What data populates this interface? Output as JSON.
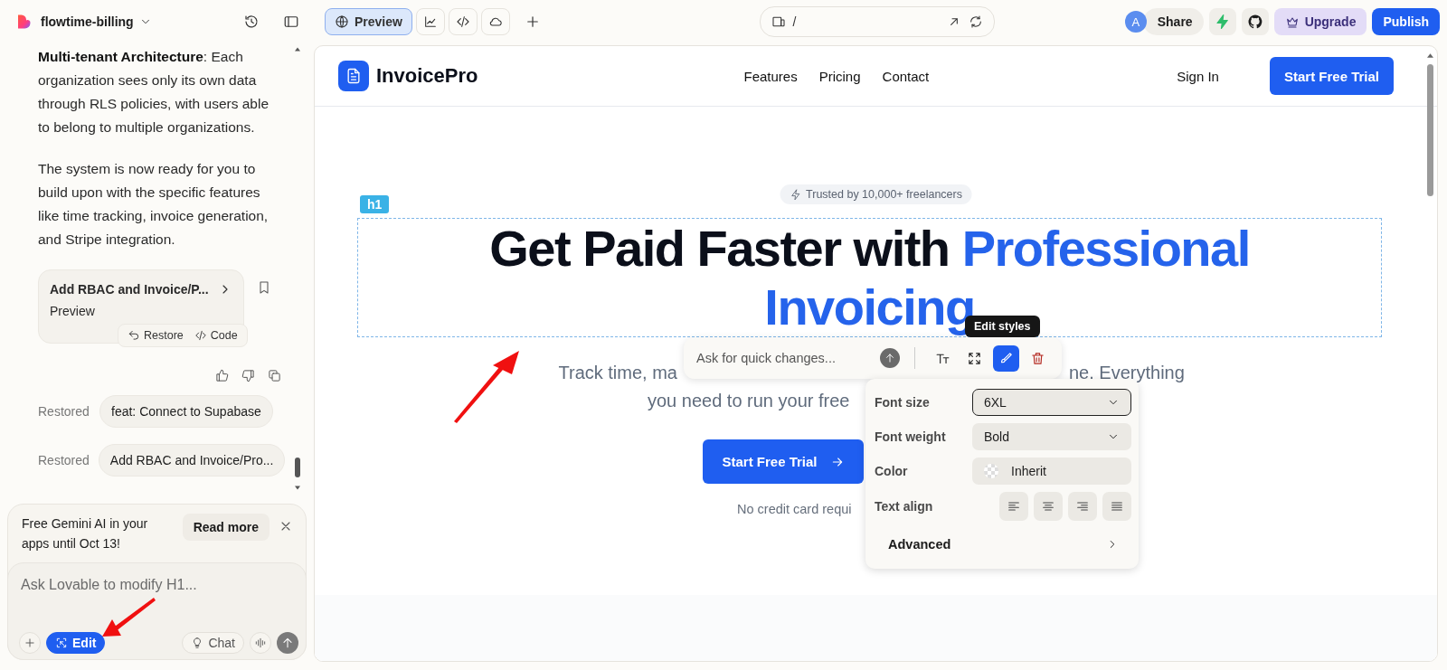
{
  "project": {
    "name": "flowtime-billing"
  },
  "view_tabs": [
    {
      "kind": "preview",
      "label": "Preview",
      "selected": true
    },
    {
      "kind": "chart",
      "selected": false
    },
    {
      "kind": "code",
      "selected": false
    },
    {
      "kind": "cloud",
      "selected": false
    }
  ],
  "address_bar": {
    "path": "/"
  },
  "header_actions": {
    "avatar": "A",
    "share": "Share",
    "upgrade": "Upgrade",
    "publish": "Publish"
  },
  "chat": {
    "paragraphs": [
      "**Multi-tenant Architecture**: Each organization sees only its own data through RLS policies, with users able to belong to multiple organizations.",
      "The system is now ready for you to build upon with the specific features like time tracking, invoice generation, and Stripe integration."
    ],
    "version_card": {
      "title": "Add RBAC and Invoice/P...",
      "subtitle": "Preview",
      "actions": [
        {
          "kind": "restore",
          "label": "Restore"
        },
        {
          "kind": "code",
          "label": "Code"
        }
      ]
    },
    "history": [
      {
        "label": "Restored",
        "commit": "feat: Connect to Supabase"
      },
      {
        "label": "Restored",
        "commit": "Add RBAC and Invoice/Pro..."
      }
    ]
  },
  "promo": {
    "text": "Free Gemini AI in your apps until Oct 13!",
    "button": "Read more"
  },
  "composer": {
    "placeholder": "Ask Lovable to modify H1...",
    "modes": [
      {
        "kind": "edit",
        "label": "Edit",
        "selected": true
      },
      {
        "kind": "chat",
        "label": "Chat",
        "selected": false
      }
    ]
  },
  "site": {
    "brand": "InvoicePro",
    "nav": [
      "Features",
      "Pricing",
      "Contact"
    ],
    "sign_in": "Sign In",
    "cta": "Start Free Trial",
    "badge": "Trusted by 10,000+ freelancers",
    "element_tag": "h1",
    "heading": {
      "text": "Get Paid Faster with",
      "highlight": "Professional Invoicing"
    },
    "subtitle": {
      "line_1_start": "Track time, ma",
      "line_1_end": "ne. Everything",
      "line_2_start": "you need to run your free"
    },
    "hero_cta": "Start Free Trial",
    "note": "No credit card requi"
  },
  "quick_edit": {
    "placeholder": "Ask for quick changes...",
    "tooltip": "Edit styles",
    "tools": [
      {
        "kind": "text",
        "selected": false
      },
      {
        "kind": "resize",
        "selected": false
      },
      {
        "kind": "styles",
        "selected": true
      },
      {
        "kind": "delete",
        "selected": false
      }
    ]
  },
  "style_panel": {
    "font_size": {
      "label": "Font size",
      "value": "6XL",
      "focused": true
    },
    "font_weight": {
      "label": "Font weight",
      "value": "Bold"
    },
    "color": {
      "label": "Color",
      "value": "Inherit"
    },
    "text_align": {
      "label": "Text align",
      "options": [
        {
          "kind": "left"
        },
        {
          "kind": "center"
        },
        {
          "kind": "right"
        },
        {
          "kind": "justify"
        }
      ]
    },
    "advanced": "Advanced"
  }
}
